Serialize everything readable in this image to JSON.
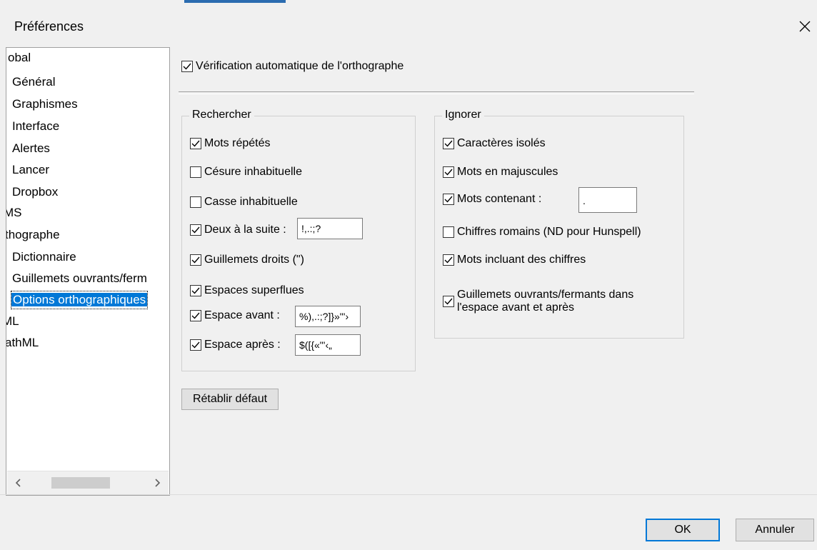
{
  "window": {
    "title": "Préférences",
    "close_icon": "close-icon"
  },
  "tree": {
    "items": [
      {
        "label": "obal"
      },
      {
        "label": "Général"
      },
      {
        "label": "Graphismes"
      },
      {
        "label": "Interface"
      },
      {
        "label": "Alertes"
      },
      {
        "label": "Lancer"
      },
      {
        "label": "Dropbox"
      },
      {
        "label": "MS"
      },
      {
        "label": "thographe"
      },
      {
        "label": "Dictionnaire"
      },
      {
        "label": "Guillemets ouvrants/ferm"
      },
      {
        "label": "Options orthographiques",
        "selected": true
      },
      {
        "label": "ML"
      },
      {
        "label": "athML"
      }
    ]
  },
  "options": {
    "auto_spellcheck": {
      "label": "Vérification automatique de l'orthographe",
      "checked": true
    }
  },
  "rechercher": {
    "title": "Rechercher",
    "mots_repetes": {
      "label": "Mots répétés",
      "checked": true
    },
    "cesure": {
      "label": "Césure inhabituelle",
      "checked": false
    },
    "casse": {
      "label": "Casse inhabituelle",
      "checked": false
    },
    "deux_suite": {
      "label": "Deux à la suite :",
      "checked": true,
      "value": "!,.:;?"
    },
    "guillemets_droits": {
      "label": "Guillemets droits (\")",
      "checked": true
    },
    "espaces_superflues": {
      "label": "Espaces superflues",
      "checked": true
    },
    "espace_avant": {
      "label": "Espace avant :",
      "checked": true,
      "value": "%),.:;?]}»\"'›"
    },
    "espace_apres": {
      "label": "Espace après :",
      "checked": true,
      "value": "$([{«\"'‹„"
    }
  },
  "ignorer": {
    "title": "Ignorer",
    "caracteres_isoles": {
      "label": "Caractères isolés",
      "checked": true
    },
    "mots_majuscules": {
      "label": "Mots en majuscules",
      "checked": true
    },
    "mots_contenant": {
      "label": "Mots contenant :",
      "checked": true,
      "value": "."
    },
    "chiffres_romains": {
      "label": "Chiffres romains (ND pour Hunspell)",
      "checked": false
    },
    "mots_chiffres": {
      "label": "Mots incluant des chiffres",
      "checked": true
    },
    "guillemets_ouvrants": {
      "label": "Guillemets ouvrants/fermants dans l'espace avant et après",
      "checked": true
    }
  },
  "buttons": {
    "reset": "Rétablir défaut",
    "ok": "OK",
    "cancel": "Annuler"
  }
}
